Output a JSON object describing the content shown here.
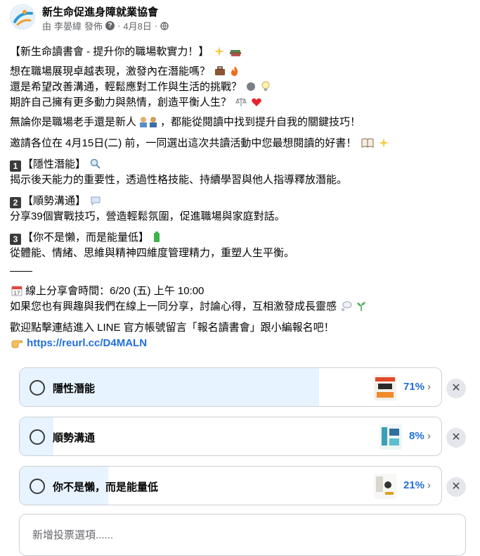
{
  "header": {
    "page_name": "新生命促進身障就業協會",
    "by": "由",
    "author": "李晏緯",
    "posted": "發佈",
    "question_mark": "?",
    "dot": "·",
    "date": "4月8日"
  },
  "post": {
    "title": "【新生命讀書會 - 提升你的職場軟實力！】",
    "p1": "想在職場展現卓越表現，激發內在潛能嗎？",
    "p2": "還是希望改善溝通，輕鬆應對工作與生活的挑戰？",
    "p3": "期許自己擁有更多動力與熱情，創造平衡人生？",
    "p4a": "無論你是職場老手還是新人",
    "p4b": "，都能從閱讀中找到提升自我的關鍵技巧！",
    "p5": "邀請各位在 4月15日(二) 前，一同選出這次共讀活動中您最想閱讀的好書！",
    "item1_num": "1",
    "item1_title": "【隱性潛能】",
    "item1_desc": "揭示後天能力的重要性，透過性格技能、持續學習與他人指導釋放潛能。",
    "item2_num": "2",
    "item2_title": "【順勢溝通】",
    "item2_desc": "分享39個實戰技巧，營造輕鬆氛圍，促進職場與家庭對話。",
    "item3_num": "3",
    "item3_title": "【你不是懶，而是能量低】",
    "item3_desc": "從體能、情緒、思維與精神四維度管理精力，重塑人生平衡。",
    "share_time": "線上分享會時間：6/20 (五) 上午 10:00",
    "share_invite": "如果您也有興趣與我們在線上一同分享，討論心得，互相激發成長靈感",
    "line_text": "歡迎點擊連結進入 LINE 官方帳號留言「報名讀書會」跟小編報名吧！",
    "link": "https://reurl.cc/D4MALN"
  },
  "poll": {
    "options": [
      {
        "label": "隱性潛能",
        "percent": 71,
        "percent_text": "71%"
      },
      {
        "label": "順勢溝通",
        "percent": 8,
        "percent_text": "8%"
      },
      {
        "label": "你不是懶，而是能量低",
        "percent": 21,
        "percent_text": "21%"
      }
    ],
    "chevron": "›",
    "remove": "✕",
    "add_placeholder": "新增投票選項......"
  },
  "icons": [
    "avatar-logo",
    "help-icon",
    "globe-icon",
    "sparkles-icon",
    "books-icon",
    "briefcase-icon",
    "fire-icon",
    "speaking-head-icon",
    "lightbulb-icon",
    "scales-icon",
    "heart-icon",
    "people-icon",
    "open-book-icon",
    "magnifier-icon",
    "speech-bubble-icon",
    "battery-icon",
    "calendar-icon",
    "thought-bubble-icon",
    "seedling-icon",
    "pointing-hand-icon",
    "radio-icon",
    "book-cover-icon",
    "chevron-right-icon",
    "remove-icon"
  ],
  "colors": {
    "accent": "#216fdb",
    "poll_fill": "#e7f3ff",
    "text": "#050505",
    "muted": "#65676b"
  }
}
